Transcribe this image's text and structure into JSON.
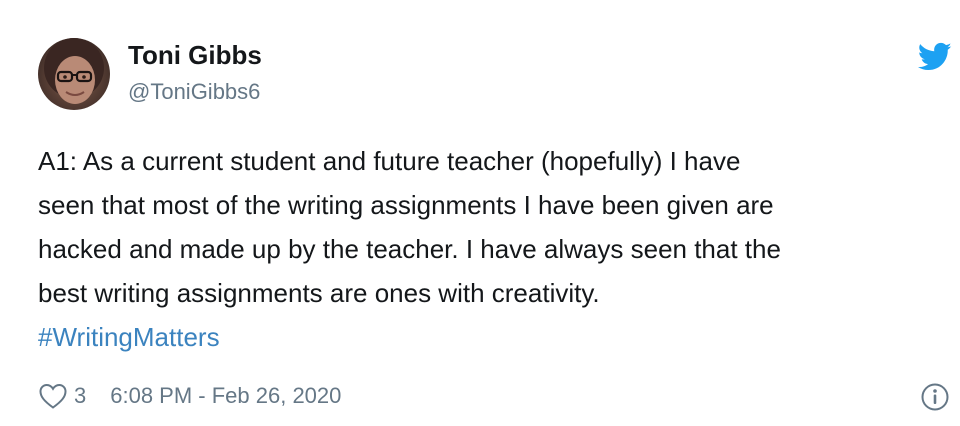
{
  "user": {
    "display_name": "Toni Gibbs",
    "handle": "@ToniGibbs6"
  },
  "tweet": {
    "lines": [
      "A1: As a current student and future teacher (hopefully) I have",
      "seen that most of the writing assignments I have been given are",
      "hacked and made up by the teacher. I have always seen that the",
      "best writing assignments are ones with creativity."
    ],
    "hashtag": "#WritingMatters"
  },
  "footer": {
    "like_count": "3",
    "timestamp": "6:08 PM - Feb 26, 2020"
  },
  "icons": {
    "brand": "twitter-bird-icon",
    "like": "heart-outline-icon",
    "info": "info-circle-icon"
  },
  "colors": {
    "brand_blue": "#1da1f2",
    "hashtag_blue": "#3b83bf",
    "secondary_text": "#657786",
    "primary_text": "#14171a"
  }
}
